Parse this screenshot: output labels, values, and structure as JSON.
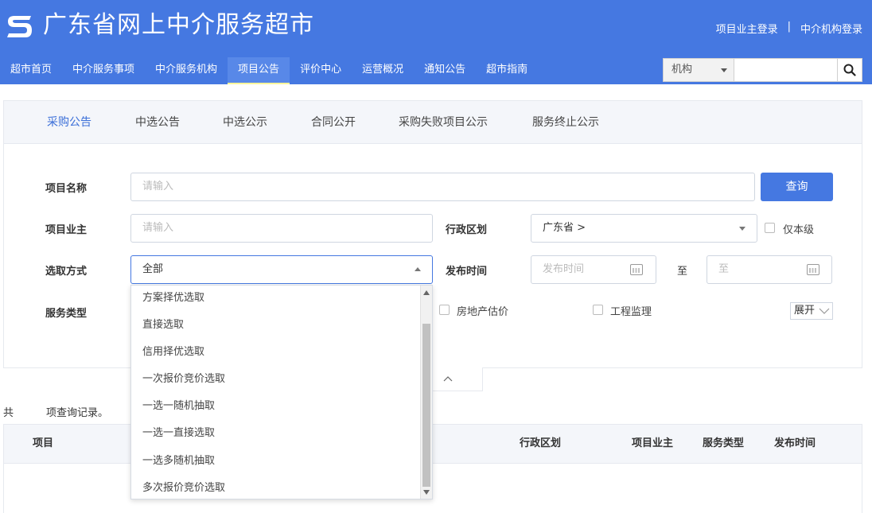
{
  "header": {
    "site_title": "广东省网上中介服务超市",
    "login_owner": "项目业主登录",
    "login_sep": "|",
    "login_agency": "中介机构登录",
    "logo_icon": "s-logo-icon",
    "brand_color": "#4578e1"
  },
  "nav": {
    "items": [
      "超市首页",
      "中介服务事项",
      "中介服务机构",
      "项目公告",
      "评价中心",
      "运营概况",
      "通知公告",
      "超市指南"
    ],
    "active": "项目公告"
  },
  "search": {
    "category_value": "机构",
    "input_value": "",
    "button_icon": "search-icon"
  },
  "tabs": {
    "items": [
      "采购公告",
      "中选公告",
      "中选公示",
      "合同公开",
      "采购失败项目公示",
      "服务终止公示"
    ],
    "active": "采购公告"
  },
  "form": {
    "project_name_label": "项目名称",
    "project_name_placeholder": "请输入",
    "query_button": "查询",
    "owner_label": "项目业主",
    "owner_placeholder": "请输入",
    "region_label": "行政区划",
    "region_value": "广东省 >",
    "only_level_label": "仅本级",
    "select_method_label": "选取方式",
    "select_method_value": "全部",
    "publish_time_label": "发布时间",
    "publish_time_placeholder": "发布时间",
    "to_label": "至",
    "to_placeholder": "至",
    "service_type_label": "服务类型",
    "service_types": [
      "房地产估价",
      "工程监理"
    ],
    "expand_label": "展开"
  },
  "dropdown": {
    "options": [
      "方案择优选取",
      "直接选取",
      "信用择优选取",
      "一次报价竞价选取",
      "一选一随机抽取",
      "一选一直接选取",
      "一选多随机抽取",
      "多次报价竞价选取"
    ]
  },
  "results": {
    "prefix": "共",
    "suffix": "项查询记录。",
    "columns": [
      "项目",
      "行政区划",
      "项目业主",
      "服务类型",
      "发布时间"
    ]
  }
}
